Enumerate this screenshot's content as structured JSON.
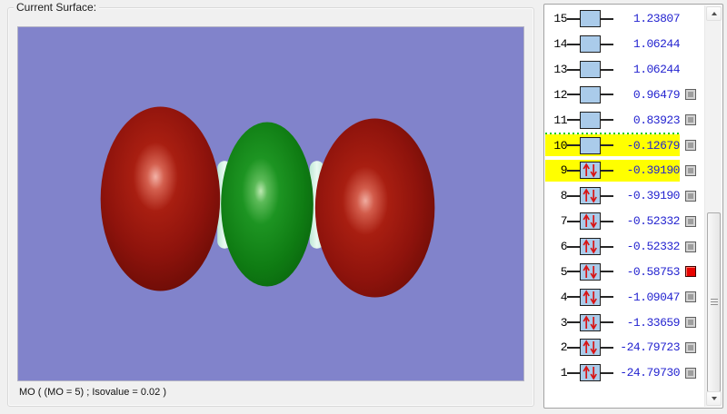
{
  "surface_panel": {
    "title": "Current Surface:",
    "caption": "MO ( (MO = 5) ; Isovalue = 0.02 )",
    "viewport_bg": "#8183cb",
    "lobe_colors": {
      "negative_phase": "#8e130c",
      "positive_phase": "#0f7c13",
      "atom_sliver": "#d8f2e4"
    }
  },
  "mo_list": {
    "colors": {
      "energy_text": "#2424d0",
      "number_text": "#000000",
      "row_highlight": "#ffff00",
      "homo_lumo_divider": "#1ecb1e",
      "occupancy_box_fill": "#aacbea",
      "spin_arrow": "#d81414",
      "selected_checkbox": "#e80300"
    },
    "rows": [
      {
        "number": "15",
        "energy": "1.23807",
        "occupied": false,
        "checkbox": false,
        "selected": false,
        "highlighted": false
      },
      {
        "number": "14",
        "energy": "1.06244",
        "occupied": false,
        "checkbox": false,
        "selected": false,
        "highlighted": false
      },
      {
        "number": "13",
        "energy": "1.06244",
        "occupied": false,
        "checkbox": false,
        "selected": false,
        "highlighted": false
      },
      {
        "number": "12",
        "energy": "0.96479",
        "occupied": false,
        "checkbox": true,
        "selected": false,
        "highlighted": false
      },
      {
        "number": "11",
        "energy": "0.83923",
        "occupied": false,
        "checkbox": true,
        "selected": false,
        "highlighted": false
      },
      {
        "number": "10",
        "energy": "-0.12679",
        "occupied": false,
        "checkbox": true,
        "selected": false,
        "highlighted": true
      },
      {
        "number": "9",
        "energy": "-0.39190",
        "occupied": true,
        "checkbox": true,
        "selected": false,
        "highlighted": true
      },
      {
        "number": "8",
        "energy": "-0.39190",
        "occupied": true,
        "checkbox": true,
        "selected": false,
        "highlighted": false
      },
      {
        "number": "7",
        "energy": "-0.52332",
        "occupied": true,
        "checkbox": true,
        "selected": false,
        "highlighted": false
      },
      {
        "number": "6",
        "energy": "-0.52332",
        "occupied": true,
        "checkbox": true,
        "selected": false,
        "highlighted": false
      },
      {
        "number": "5",
        "energy": "-0.58753",
        "occupied": true,
        "checkbox": true,
        "selected": true,
        "highlighted": false
      },
      {
        "number": "4",
        "energy": "-1.09047",
        "occupied": true,
        "checkbox": true,
        "selected": false,
        "highlighted": false
      },
      {
        "number": "3",
        "energy": "-1.33659",
        "occupied": true,
        "checkbox": true,
        "selected": false,
        "highlighted": false
      },
      {
        "number": "2",
        "energy": "-24.79723",
        "occupied": true,
        "checkbox": true,
        "selected": false,
        "highlighted": false
      },
      {
        "number": "1",
        "energy": "-24.79730",
        "occupied": true,
        "checkbox": true,
        "selected": false,
        "highlighted": false
      }
    ]
  }
}
